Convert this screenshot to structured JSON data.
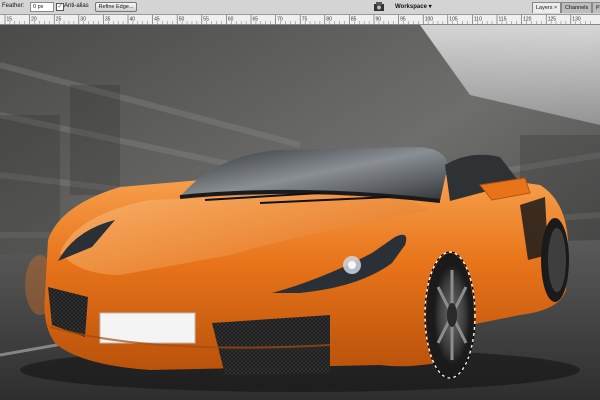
{
  "options_bar": {
    "feather_label": "Feather:",
    "feather_value": "0 px",
    "antialias_checked": "✓",
    "antialias_label": "Anti-alias",
    "refine_edge_label": "Refine Edge...",
    "workspace_icon": "workspace-icon",
    "workspace_label": "Workspace ▾"
  },
  "panel_tabs": {
    "layers": "Layers",
    "close_glyph": "×",
    "channels": "Channels",
    "paths": "Pa"
  },
  "ruler": {
    "ticks": [
      "15",
      "20",
      "25",
      "30",
      "35",
      "40",
      "45",
      "50",
      "55",
      "60",
      "65",
      "70",
      "75",
      "80",
      "85",
      "90",
      "95",
      "100",
      "105",
      "110",
      "115",
      "120",
      "125",
      "130"
    ]
  },
  "canvas": {
    "subject": "orange sports car photo with motion-blurred street background",
    "selection": "marching-ants selection around front wheel",
    "accent_color": "#e8741a"
  }
}
